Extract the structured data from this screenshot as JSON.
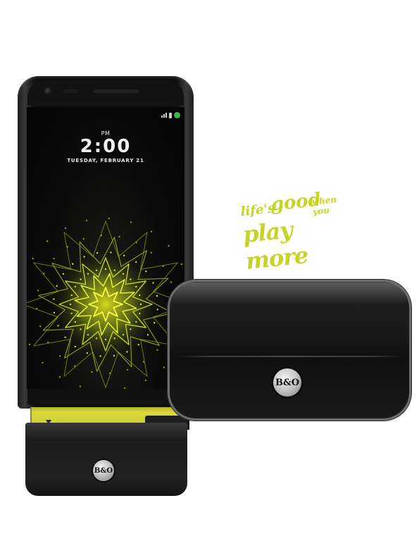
{
  "lockscreen": {
    "ampm": "PM",
    "time": "2:00",
    "date": "TUESDAY, FEBRUARY 21"
  },
  "tagline": {
    "part1": "life's",
    "part2": "good",
    "part3": "when you",
    "part4": "play more"
  },
  "logos": {
    "hifi_module": "B&O",
    "speaker": "B&O"
  },
  "colors": {
    "accent_lime": "#c5d426",
    "module_yellow": "#d9d93a",
    "status_green": "#3fb54a"
  },
  "icons": [
    "signal-icon",
    "battery-icon",
    "lg-status-icon",
    "front-camera-icon",
    "bang-olufsen-logo-icon"
  ]
}
